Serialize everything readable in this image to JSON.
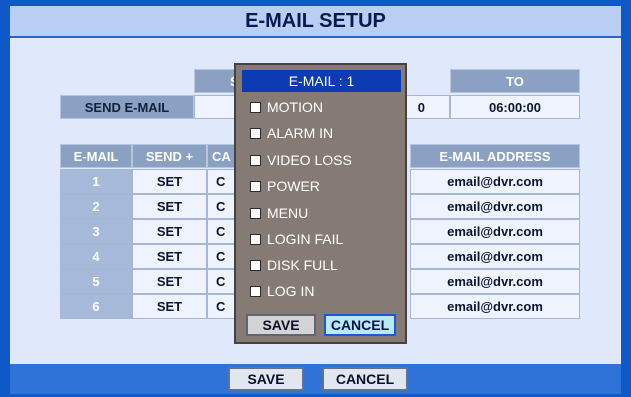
{
  "window": {
    "title": "E-MAIL SETUP"
  },
  "schedule": {
    "header_from_partial": "SC",
    "header_to": "TO",
    "row_label": "SEND E-MAIL",
    "from_partial": "0",
    "to_value": "06:00:00"
  },
  "table": {
    "headers": {
      "email": "E-MAIL",
      "send": "SEND +",
      "ca_partial": "CA",
      "address": "E-MAIL ADDRESS"
    },
    "rows": [
      {
        "num": "1",
        "send": "SET",
        "ca": "C",
        "address": "email@dvr.com"
      },
      {
        "num": "2",
        "send": "SET",
        "ca": "C",
        "address": "email@dvr.com"
      },
      {
        "num": "3",
        "send": "SET",
        "ca": "C",
        "address": "email@dvr.com"
      },
      {
        "num": "4",
        "send": "SET",
        "ca": "C",
        "address": "email@dvr.com"
      },
      {
        "num": "5",
        "send": "SET",
        "ca": "C",
        "address": "email@dvr.com"
      },
      {
        "num": "6",
        "send": "SET",
        "ca": "C",
        "address": "email@dvr.com"
      }
    ]
  },
  "popup": {
    "title": "E-MAIL : 1",
    "items": [
      "MOTION",
      "ALARM IN",
      "VIDEO LOSS",
      "POWER",
      "MENU",
      "LOGIN FAIL",
      "DISK FULL",
      "LOG IN"
    ],
    "save": "SAVE",
    "cancel": "CANCEL"
  },
  "footer": {
    "save": "SAVE",
    "cancel": "CANCEL"
  }
}
